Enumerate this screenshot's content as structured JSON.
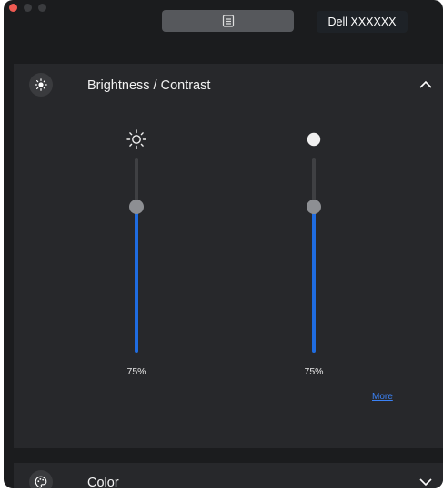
{
  "window": {
    "monitor_name": "Dell XXXXXX",
    "menu_button_icon": "list-icon"
  },
  "brightness_contrast": {
    "title": "Brightness / Contrast",
    "icon": "brightness-icon",
    "expanded": true,
    "brightness": {
      "icon": "sun-icon",
      "value": 75,
      "value_label": "75%"
    },
    "contrast": {
      "icon": "contrast-icon",
      "value": 75,
      "value_label": "75%"
    },
    "more_label": "More"
  },
  "color": {
    "title": "Color",
    "icon": "palette-icon",
    "expanded": false
  },
  "colors": {
    "accent": "#1f6ce0",
    "link": "#3b82f6",
    "window_bg": "#1b1c1e",
    "section_bg": "#27282b"
  }
}
